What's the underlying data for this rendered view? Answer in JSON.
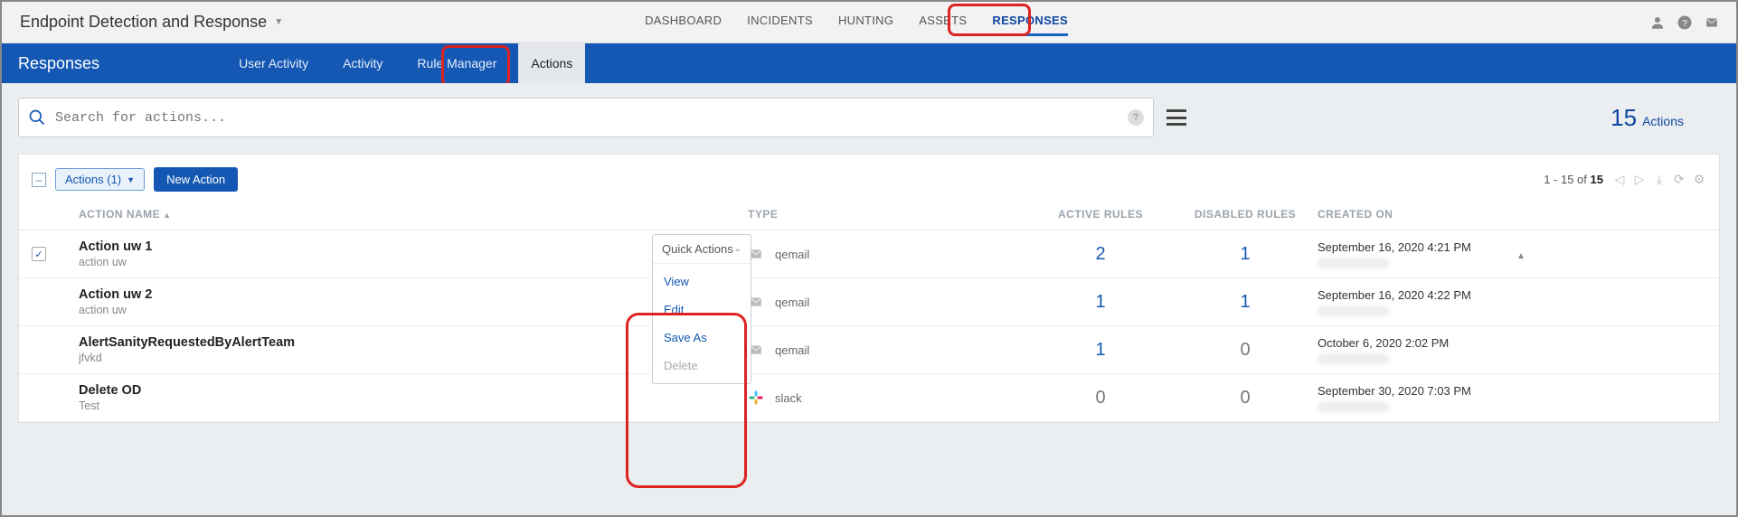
{
  "app_title": "Endpoint Detection and Response",
  "nav": [
    "DASHBOARD",
    "INCIDENTS",
    "HUNTING",
    "ASSETS",
    "RESPONSES"
  ],
  "nav_active": "RESPONSES",
  "section_title": "Responses",
  "subtabs": [
    "User Activity",
    "Activity",
    "Rule Manager",
    "Actions"
  ],
  "subtab_active": "Actions",
  "search": {
    "placeholder": "Search for actions..."
  },
  "count": {
    "num": "15",
    "lbl": "Actions"
  },
  "toolbar": {
    "actions_chip": "Actions (1)",
    "new_action": "New Action",
    "page_info_prefix": "1 - 15 of",
    "page_info_total": "15"
  },
  "columns": {
    "name": "ACTION NAME",
    "type": "TYPE",
    "active": "ACTIVE RULES",
    "disabled": "DISABLED RULES",
    "created": "CREATED ON"
  },
  "quick_actions": {
    "label": "Quick Actions",
    "items": [
      "View",
      "Edit",
      "Save As",
      "Delete"
    ],
    "disabled": [
      "Delete"
    ]
  },
  "rows": [
    {
      "checked": true,
      "title": "Action uw 1",
      "sub": "action uw",
      "type_icon": "mail",
      "type": "qemail",
      "active": "2",
      "disabled": "1",
      "active_link": true,
      "disabled_link": true,
      "created": "September 16, 2020 4:21 PM"
    },
    {
      "checked": false,
      "title": "Action uw 2",
      "sub": "action uw",
      "type_icon": "mail",
      "type": "qemail",
      "active": "1",
      "disabled": "1",
      "active_link": true,
      "disabled_link": true,
      "created": "September 16, 2020 4:22 PM"
    },
    {
      "checked": false,
      "title": "AlertSanityRequestedByAlertTeam",
      "sub": "jfvkd",
      "type_icon": "mail",
      "type": "qemail",
      "active": "1",
      "disabled": "0",
      "active_link": true,
      "disabled_link": false,
      "created": "October 6, 2020 2:02 PM"
    },
    {
      "checked": false,
      "title": "Delete OD",
      "sub": "Test",
      "type_icon": "slack",
      "type": "slack",
      "active": "0",
      "disabled": "0",
      "active_link": false,
      "disabled_link": false,
      "created": "September 30, 2020 7:03 PM"
    }
  ]
}
